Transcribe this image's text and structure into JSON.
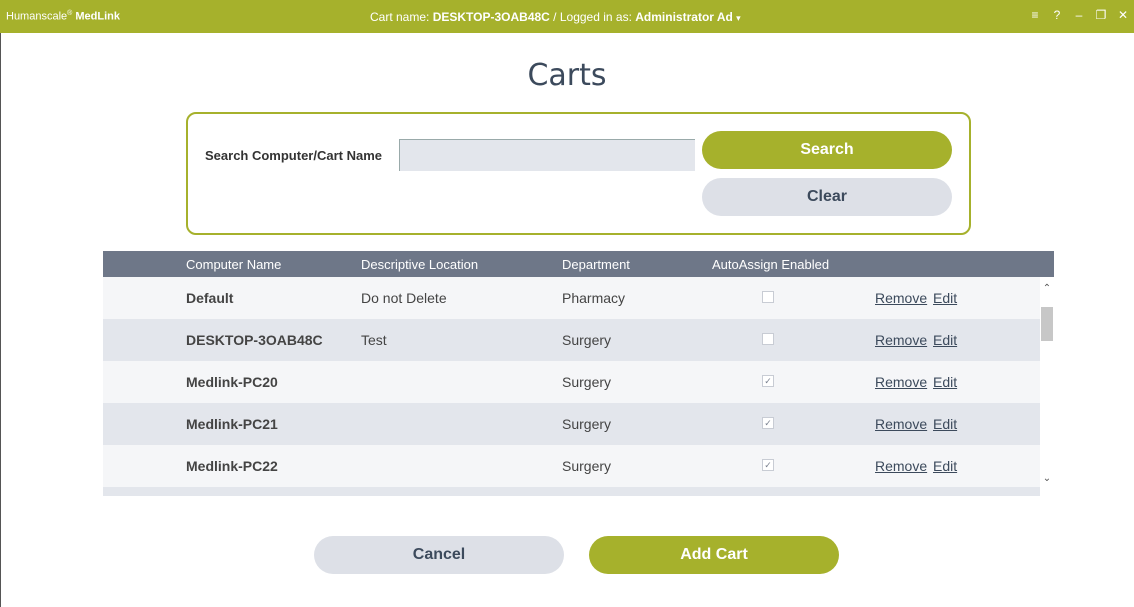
{
  "titlebar": {
    "brand_prefix": "Humanscale",
    "brand_mark": "®",
    "brand_suffix": " MedLink",
    "cart_label": "Cart name:",
    "cart_name": "DESKTOP-3OAB48C",
    "separator": " / ",
    "logged_label": "Logged in as:",
    "user_name": "Administrator Ad",
    "user_caret": "▾",
    "controls": {
      "menu": "≡",
      "help": "?",
      "minimize": "–",
      "restore": "❐",
      "close": "✕"
    },
    "bar_color": "#a6b12c"
  },
  "page": {
    "title": "Carts"
  },
  "search": {
    "label": "Search Computer/Cart Name",
    "value": "",
    "search_button": "Search",
    "clear_button": "Clear"
  },
  "table": {
    "headers": [
      "Computer Name",
      "Descriptive Location",
      "Department",
      "AutoAssign Enabled"
    ],
    "rows": [
      {
        "name": "Default",
        "location": "Do not Delete",
        "department": "Pharmacy",
        "auto_assign": false,
        "remove": "Remove",
        "edit": "Edit"
      },
      {
        "name": "DESKTOP-3OAB48C",
        "location": "Test",
        "department": "Surgery",
        "auto_assign": false,
        "remove": "Remove",
        "edit": "Edit"
      },
      {
        "name": "Medlink-PC20",
        "location": "",
        "department": "Surgery",
        "auto_assign": true,
        "remove": "Remove",
        "edit": "Edit"
      },
      {
        "name": "Medlink-PC21",
        "location": "",
        "department": "Surgery",
        "auto_assign": true,
        "remove": "Remove",
        "edit": "Edit"
      },
      {
        "name": "Medlink-PC22",
        "location": "",
        "department": "Surgery",
        "auto_assign": true,
        "remove": "Remove",
        "edit": "Edit"
      }
    ],
    "scroll_up": "⌃",
    "scroll_down": "⌄"
  },
  "footer": {
    "cancel_button": "Cancel",
    "add_button": "Add Cart"
  },
  "colors": {
    "accent": "#a6b12c",
    "header_bg": "#6e7788",
    "gray_button": "#dde0e7"
  }
}
